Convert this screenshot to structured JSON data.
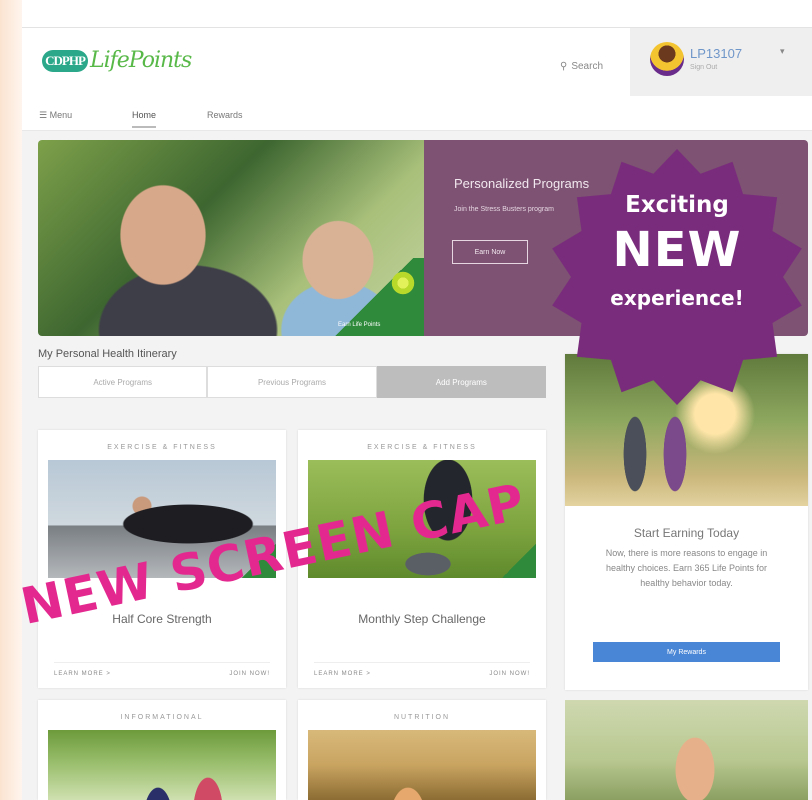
{
  "header": {
    "logo_badge": "CDPHP",
    "logo_text": "LifePoints",
    "search_label": "Search",
    "account_id": "LP13107",
    "account_sub": "Sign Out"
  },
  "nav": {
    "menu": "Menu",
    "home": "Home",
    "rewards": "Rewards"
  },
  "hero": {
    "title": "Personalized Programs",
    "subtitle": "Join the Stress Busters program",
    "button": "Earn Now",
    "badge": "Earn Life Points"
  },
  "itinerary": {
    "title": "My Personal Health Itinerary",
    "tabs": [
      {
        "label": "Active Programs",
        "active": false
      },
      {
        "label": "Previous Programs",
        "active": false
      },
      {
        "label": "Add Programs",
        "active": true
      }
    ]
  },
  "cards": [
    {
      "category": "EXERCISE & FITNESS",
      "title": "Half Core Strength",
      "learn": "LEARN MORE >",
      "join": "JOIN NOW!"
    },
    {
      "category": "EXERCISE & FITNESS",
      "title": "Monthly Step Challenge",
      "learn": "LEARN MORE >",
      "join": "JOIN NOW!"
    },
    {
      "category": "INFORMATIONAL",
      "title": "",
      "learn": "",
      "join": ""
    },
    {
      "category": "NUTRITION",
      "title": "",
      "learn": "",
      "join": ""
    }
  ],
  "side": {
    "title": "Start Earning Today",
    "body": "Now, there is more reasons to engage in healthy choices. Earn 365 Life Points for healthy behavior today.",
    "button": "My Rewards"
  },
  "promo": {
    "line1": "Exciting",
    "line2": "NEW",
    "line3": "experience!",
    "color": "#7a2c7c"
  },
  "stamp": {
    "text": "NEW SCREEN CAP",
    "color": "#e3298f"
  }
}
